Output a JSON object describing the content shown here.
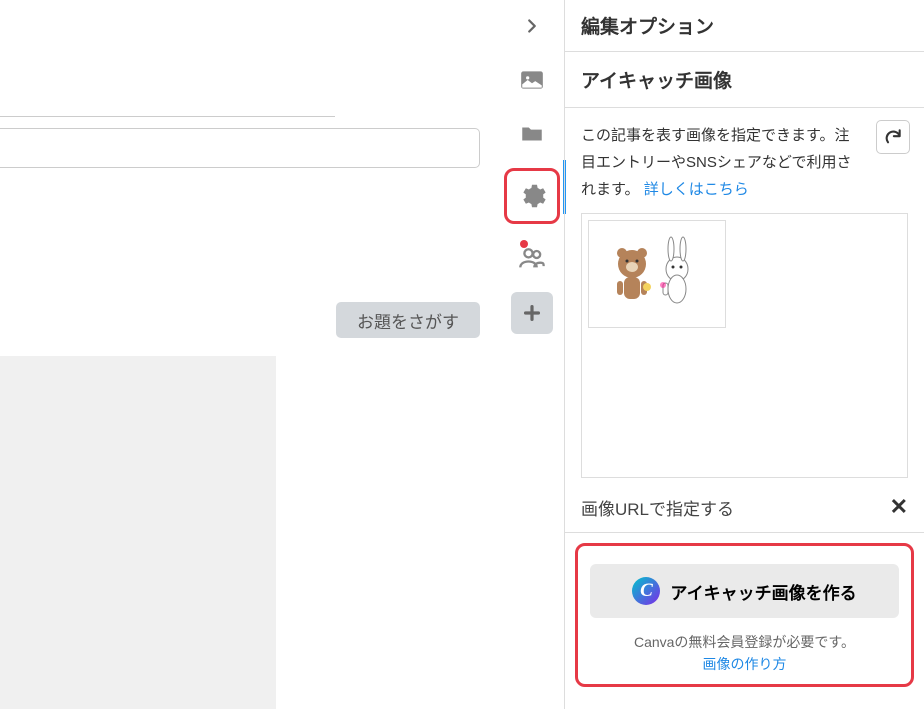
{
  "editor": {
    "search_topic_label": "お題をさがす"
  },
  "sidebar_icons": {
    "collapse": "chevron-right",
    "image": "image",
    "folder": "folder",
    "settings": "gear",
    "people": "people",
    "add": "plus"
  },
  "right_panel": {
    "title": "編集オプション",
    "eyecatch": {
      "section_title": "アイキャッチ画像",
      "description_pre": "この記事を表す画像を指定できます。注目エントリーやSNSシェアなどで利用されます。",
      "description_link": "詳しくはこちら",
      "url_section_label": "画像URLで指定する",
      "thumbnail_alt": "bear-and-rabbit-illustration"
    },
    "canva": {
      "button_label": "アイキャッチ画像を作る",
      "note": "Canvaの無料会員登録が必要です。",
      "howto_link": "画像の作り方",
      "logo_letter": "C"
    }
  }
}
